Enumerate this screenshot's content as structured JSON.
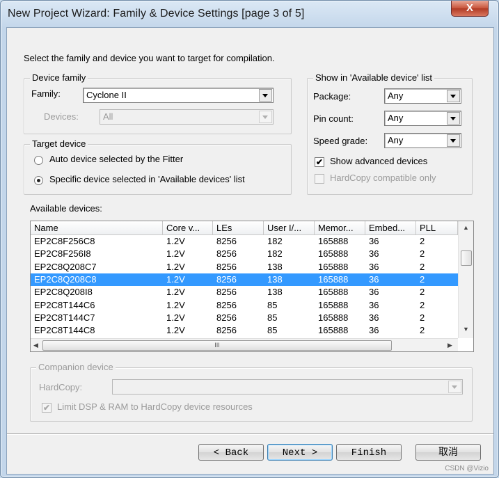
{
  "window": {
    "title": "New Project Wizard: Family & Device Settings [page 3 of 5]",
    "close_glyph": "X"
  },
  "intro_text": "Select the family and device you want to target for compilation.",
  "device_family": {
    "group_label": "Device family",
    "family_label": "Family:",
    "family_value": "Cyclone II",
    "devices_label": "Devices:",
    "devices_value": "All"
  },
  "target_device": {
    "group_label": "Target device",
    "options": [
      {
        "label": "Auto device selected by the Fitter",
        "selected": false
      },
      {
        "label": "Specific device selected in 'Available devices' list",
        "selected": true
      }
    ]
  },
  "show_in_list": {
    "group_label": "Show in 'Available device' list",
    "package_label": "Package:",
    "package_value": "Any",
    "pin_count_label": "Pin count:",
    "pin_count_value": "Any",
    "speed_grade_label": "Speed grade:",
    "speed_grade_value": "Any",
    "show_advanced_label": "Show advanced devices",
    "show_advanced_checked": true,
    "hardcopy_compatible_label": "HardCopy compatible only",
    "hardcopy_compatible_checked": false
  },
  "available_devices": {
    "label": "Available devices:",
    "columns": [
      "Name",
      "Core v...",
      "LEs",
      "User I/...",
      "Memor...",
      "Embed...",
      "PLL"
    ],
    "rows": [
      [
        "EP2C8F256C8",
        "1.2V",
        "8256",
        "182",
        "165888",
        "36",
        "2"
      ],
      [
        "EP2C8F256I8",
        "1.2V",
        "8256",
        "182",
        "165888",
        "36",
        "2"
      ],
      [
        "EP2C8Q208C7",
        "1.2V",
        "8256",
        "138",
        "165888",
        "36",
        "2"
      ],
      [
        "EP2C8Q208C8",
        "1.2V",
        "8256",
        "138",
        "165888",
        "36",
        "2"
      ],
      [
        "EP2C8Q208I8",
        "1.2V",
        "8256",
        "138",
        "165888",
        "36",
        "2"
      ],
      [
        "EP2C8T144C6",
        "1.2V",
        "8256",
        "85",
        "165888",
        "36",
        "2"
      ],
      [
        "EP2C8T144C7",
        "1.2V",
        "8256",
        "85",
        "165888",
        "36",
        "2"
      ],
      [
        "EP2C8T144C8",
        "1.2V",
        "8256",
        "85",
        "165888",
        "36",
        "2"
      ]
    ],
    "selected_row": 3,
    "hscroll_grip": "III"
  },
  "companion_device": {
    "group_label": "Companion device",
    "hardcopy_label": "HardCopy:",
    "hardcopy_value": "",
    "limit_label": "Limit DSP & RAM to HardCopy device resources",
    "limit_checked": true
  },
  "buttons": {
    "back": "< Back",
    "next": "Next >",
    "finish": "Finish",
    "cancel": "取消"
  },
  "watermark": "CSDN @Vizio"
}
